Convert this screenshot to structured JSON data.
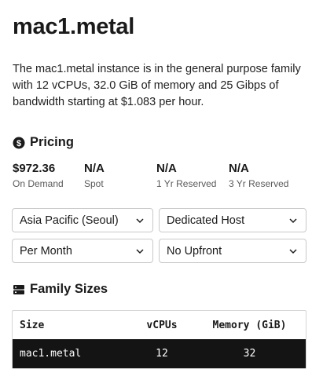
{
  "page": {
    "title": "mac1.metal",
    "description": "The mac1.metal instance is in the general purpose family with 12 vCPUs, 32.0 GiB of memory and 25 Gibps of bandwidth starting at $1.083 per hour."
  },
  "pricing": {
    "heading": "Pricing",
    "icon": "dollar-circle-icon",
    "items": [
      {
        "value": "$972.36",
        "label": "On Demand"
      },
      {
        "value": "N/A",
        "label": "Spot"
      },
      {
        "value": "N/A",
        "label": "1 Yr Reserved"
      },
      {
        "value": "N/A",
        "label": "3 Yr Reserved"
      }
    ],
    "selects": {
      "region": "Asia Pacific (Seoul)",
      "tenancy": "Dedicated Host",
      "period": "Per Month",
      "payment": "No Upfront"
    }
  },
  "family": {
    "heading": "Family Sizes",
    "icon": "server-icon",
    "columns": [
      "Size",
      "vCPUs",
      "Memory (GiB)"
    ],
    "rows": [
      {
        "size": "mac1.metal",
        "vcpus": "12",
        "memory": "32"
      }
    ]
  }
}
